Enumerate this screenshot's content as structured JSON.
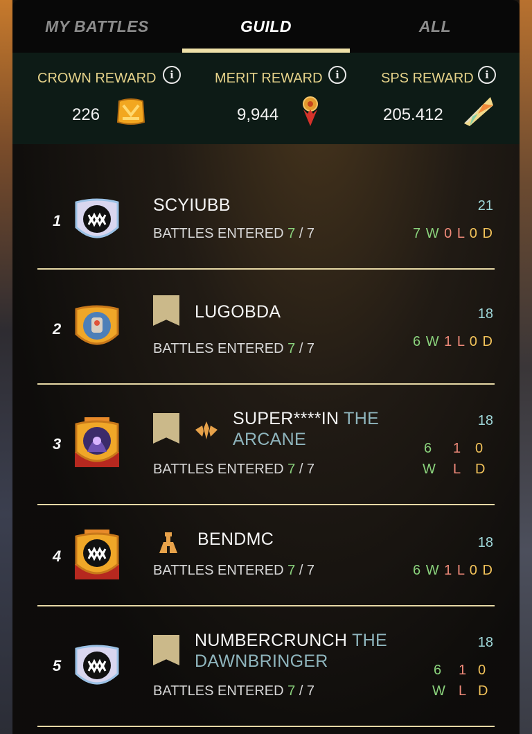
{
  "tabs": [
    {
      "label": "MY BATTLES",
      "active": false
    },
    {
      "label": "GUILD",
      "active": true
    },
    {
      "label": "ALL",
      "active": false
    }
  ],
  "rewards": [
    {
      "label": "CROWN REWARD",
      "value": "226",
      "icon": "crown-token-icon"
    },
    {
      "label": "MERIT REWARD",
      "value": "9,944",
      "icon": "merit-medal-icon"
    },
    {
      "label": "SPS REWARD",
      "value": "205.412",
      "icon": "sps-crystal-icon"
    }
  ],
  "rows": [
    {
      "rank": "1",
      "name": "SCYIUBB",
      "title": "",
      "entered_prefix": "BATTLES ENTERED",
      "entered": "7",
      "entered_total": "/ 7",
      "score": "21",
      "wins": "7",
      "w": "W",
      "losses": "0",
      "l": "L",
      "draws": "0",
      "d": "D"
    },
    {
      "rank": "2",
      "name": "LUGOBDA",
      "title": "",
      "entered_prefix": "BATTLES ENTERED",
      "entered": "7",
      "entered_total": "/ 7",
      "score": "18",
      "wins": "6",
      "w": "W",
      "losses": "1",
      "l": "L",
      "draws": "0",
      "d": "D"
    },
    {
      "rank": "3",
      "name": "SUPER****IN",
      "title": "THE",
      "title2": "ARCANE",
      "entered_prefix": "BATTLES ENTERED",
      "entered": "7",
      "entered_total": "/ 7",
      "score": "18",
      "wins": "6",
      "w": "W",
      "losses": "1",
      "l": "L",
      "draws": "0",
      "d": "D"
    },
    {
      "rank": "4",
      "name": "BENDMC",
      "title": "",
      "entered_prefix": "BATTLES ENTERED",
      "entered": "7",
      "entered_total": "/ 7",
      "score": "18",
      "wins": "6",
      "w": "W",
      "losses": "1",
      "l": "L",
      "draws": "0",
      "d": "D"
    },
    {
      "rank": "5",
      "name": "NUMBERCRUNCH",
      "title": "THE",
      "title2": "DAWNBRINGER",
      "entered_prefix": "BATTLES ENTERED",
      "entered": "7",
      "entered_total": "/ 7",
      "score": "18",
      "wins": "6",
      "w": "W",
      "losses": "1",
      "l": "L",
      "draws": "0",
      "d": "D"
    }
  ],
  "colors": {
    "accent": "#efe1a9",
    "win": "#8ad27c",
    "loss": "#f08a7a",
    "draw": "#f3c35a",
    "score": "#9ed6d8"
  }
}
